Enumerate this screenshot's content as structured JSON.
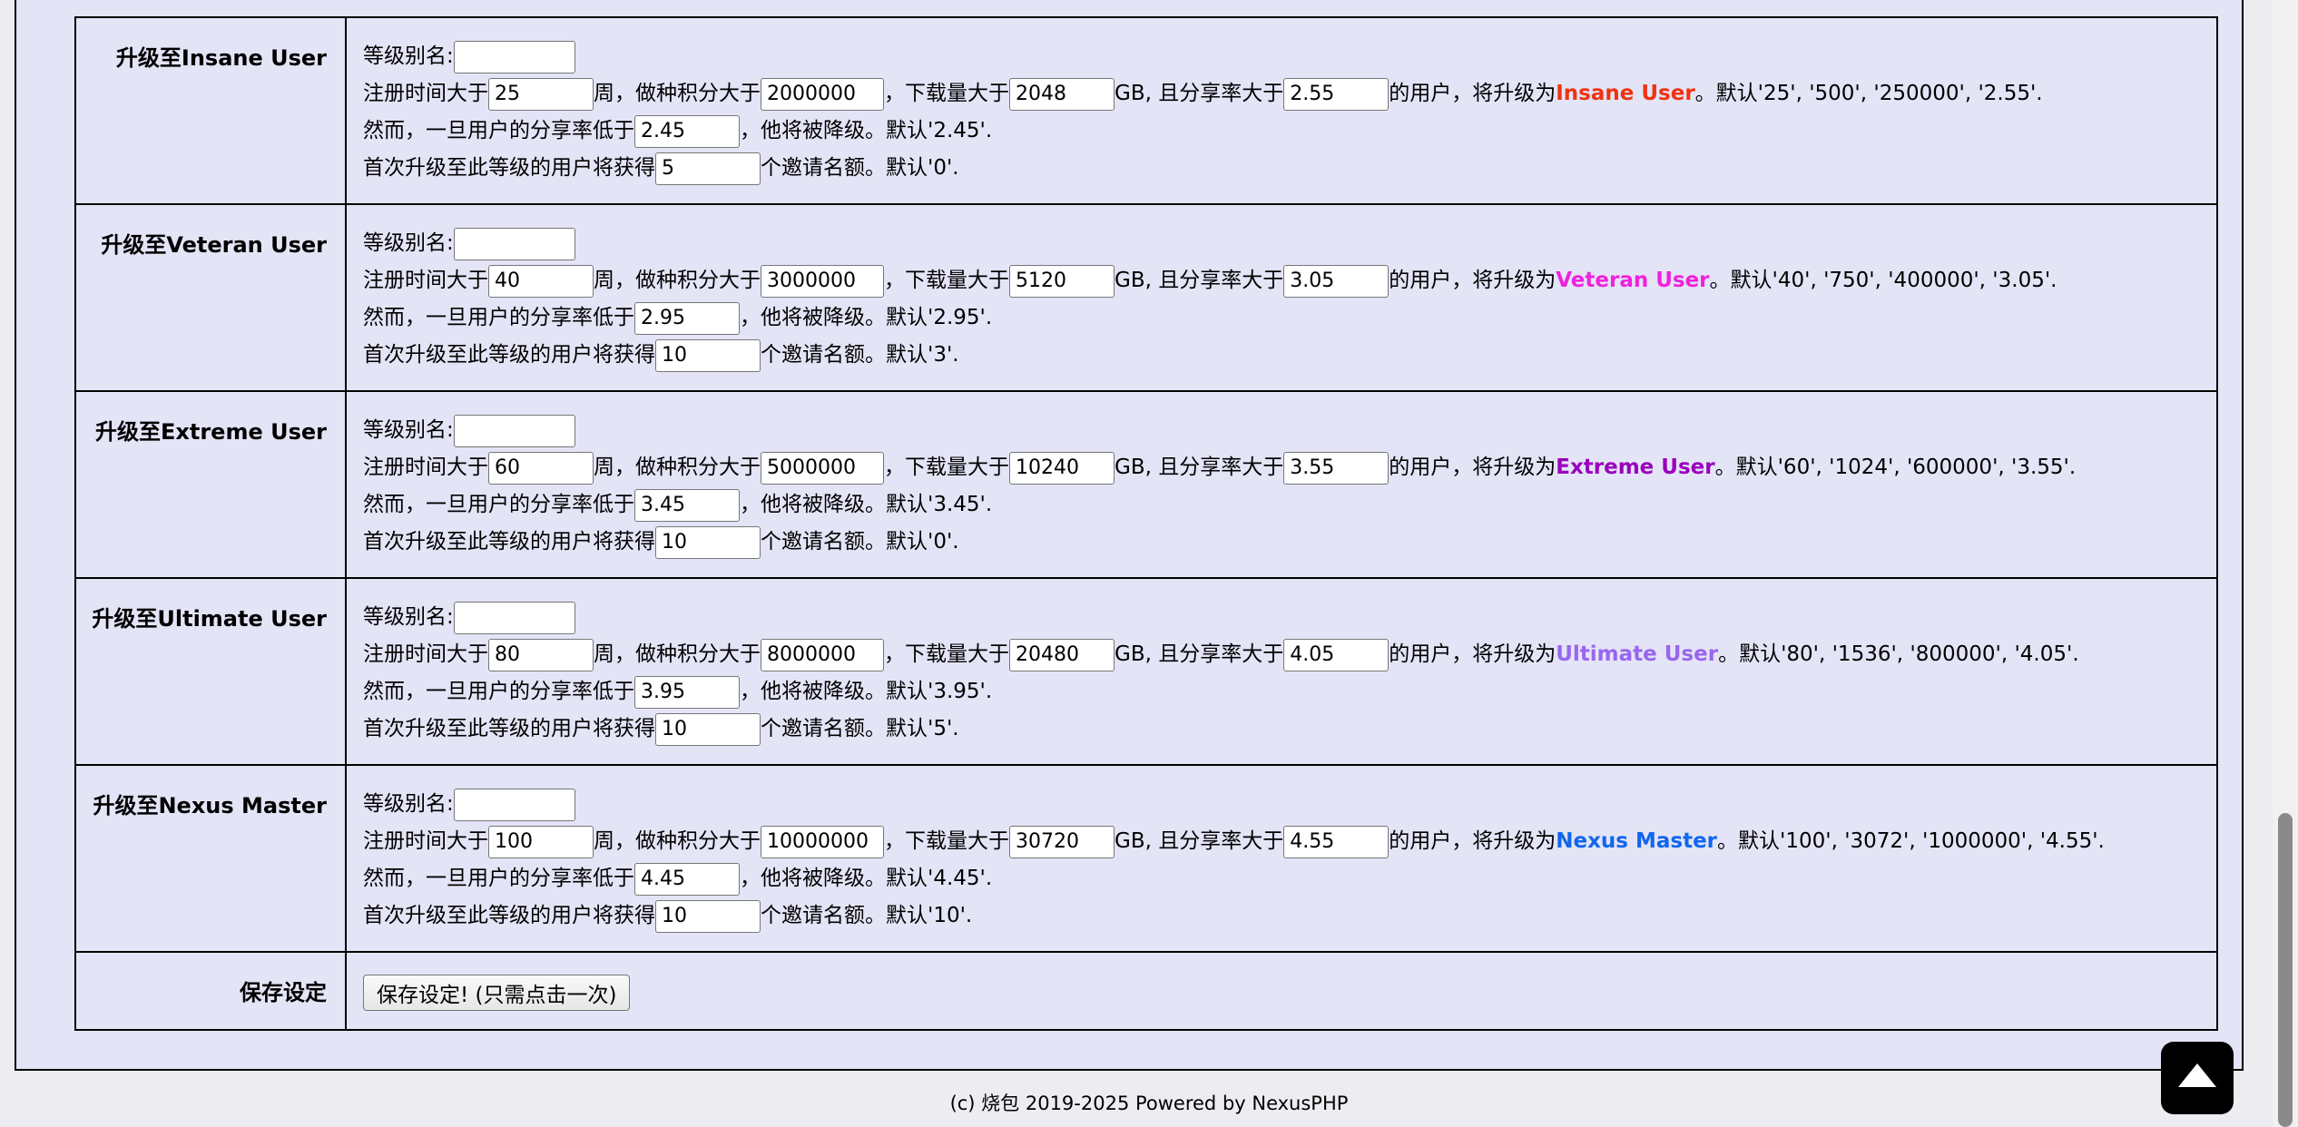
{
  "labels": {
    "alias": "等级别名:",
    "reg_prefix": "注册时间大于",
    "weeks_mid": "周，做种积分大于",
    "dl_mid": "，下载量大于",
    "ratio_mid": "GB, 且分享率大于",
    "upgrade_mid": "的用户，将升级为",
    "default_sep": "。默认",
    "demote_prefix": "然而，一旦用户的分享率低于",
    "demote_suffix": "，他将被降级。默认",
    "invite_prefix": "首次升级至此等级的用户将获得",
    "invite_suffix": "个邀请名额。默认"
  },
  "levels": [
    {
      "header": "升级至Insane User",
      "alias": "",
      "weeks": "25",
      "points": "2000000",
      "download": "2048",
      "ratio": "2.55",
      "class_name": "Insane User",
      "class_color": "#ee3311",
      "defaults": "'25', '500', '250000', '2.55'.",
      "demote_ratio": "2.45",
      "demote_default": "'2.45'.",
      "invites": "5",
      "invite_default": "'0'."
    },
    {
      "header": "升级至Veteran User",
      "alias": "",
      "weeks": "40",
      "points": "3000000",
      "download": "5120",
      "ratio": "3.05",
      "class_name": "Veteran User",
      "class_color": "#ee22dd",
      "defaults": "'40', '750', '400000', '3.05'.",
      "demote_ratio": "2.95",
      "demote_default": "'2.95'.",
      "invites": "10",
      "invite_default": "'3'."
    },
    {
      "header": "升级至Extreme User",
      "alias": "",
      "weeks": "60",
      "points": "5000000",
      "download": "10240",
      "ratio": "3.55",
      "class_name": "Extreme User",
      "class_color": "#9900bb",
      "defaults": "'60', '1024', '600000', '3.55'.",
      "demote_ratio": "3.45",
      "demote_default": "'3.45'.",
      "invites": "10",
      "invite_default": "'0'."
    },
    {
      "header": "升级至Ultimate User",
      "alias": "",
      "weeks": "80",
      "points": "8000000",
      "download": "20480",
      "ratio": "4.05",
      "class_name": "Ultimate User",
      "class_color": "#9966ee",
      "defaults": "'80', '1536', '800000', '4.05'.",
      "demote_ratio": "3.95",
      "demote_default": "'3.95'.",
      "invites": "10",
      "invite_default": "'5'."
    },
    {
      "header": "升级至Nexus Master",
      "alias": "",
      "weeks": "100",
      "points": "10000000",
      "download": "30720",
      "ratio": "4.55",
      "class_name": "Nexus Master",
      "class_color": "#1166ee",
      "defaults": "'100', '3072', '1000000', '4.55'.",
      "demote_ratio": "4.45",
      "demote_default": "'4.45'.",
      "invites": "10",
      "invite_default": "'10'."
    }
  ],
  "save": {
    "header": "保存设定",
    "button_label": "保存设定! (只需点击一次)"
  },
  "footer": {
    "text": "(c) 烧包 2019-2025 Powered by NexusPHP"
  },
  "icons": {
    "back_to_top": "triangle-up-icon"
  }
}
